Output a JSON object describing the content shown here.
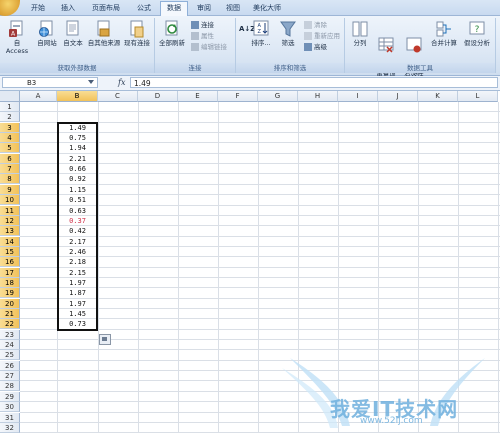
{
  "ribbon_tabs": [
    "开始",
    "插入",
    "页面布局",
    "公式",
    "数据",
    "审阅",
    "视图",
    "美化大师"
  ],
  "active_tab": "数据",
  "groups": {
    "external": {
      "label": "获取外部数据",
      "buttons": [
        "自 Access",
        "自网站",
        "自文本",
        "自其他来源",
        "现有连接"
      ]
    },
    "connections": {
      "label": "连接",
      "refresh": "全部刷新",
      "items": [
        "连接",
        "属性",
        "编辑链接"
      ]
    },
    "sort_filter": {
      "label": "排序和筛选",
      "sort_az": "A↓Z",
      "sort": "排序...",
      "filter": "筛选",
      "items": [
        "清除",
        "重新应用",
        "高级"
      ]
    },
    "data_tools": {
      "label": "数据工具",
      "buttons": [
        "分列",
        "删除\n重复项",
        "数据\n有效性",
        "合并计算",
        "假设分析"
      ]
    }
  },
  "formula_bar": {
    "name_box": "B3",
    "fx": "fx",
    "content": "1.49"
  },
  "columns": [
    "A",
    "B",
    "C",
    "D",
    "E",
    "F",
    "G",
    "H",
    "I",
    "J",
    "K",
    "L"
  ],
  "selected_column": "B",
  "rows": [
    "1",
    "2",
    "3",
    "4",
    "5",
    "6",
    "7",
    "8",
    "9",
    "10",
    "11",
    "12",
    "13",
    "14",
    "15",
    "16",
    "17",
    "18",
    "19",
    "20",
    "21",
    "22",
    "23",
    "24",
    "25",
    "26",
    "27",
    "28",
    "29",
    "30",
    "31",
    "32"
  ],
  "selected_rows": [
    "3",
    "4",
    "5",
    "6",
    "7",
    "8",
    "9",
    "10",
    "11",
    "12",
    "13",
    "14",
    "15",
    "16",
    "17",
    "18",
    "19",
    "20",
    "21",
    "22"
  ],
  "cells_b": [
    "1.49",
    "0.75",
    "1.94",
    "2.21",
    "0.66",
    "0.92",
    "1.15",
    "0.51",
    "0.63",
    "0.37",
    "0.42",
    "2.17",
    "2.46",
    "2.18",
    "2.15",
    "1.97",
    "1.87",
    "1.97",
    "1.45",
    "0.73"
  ],
  "highlight_value_index": 9,
  "colors": {
    "accent": "#d0304a",
    "selection": "#111111",
    "ribbon": "#dde8f5"
  },
  "watermark": {
    "text": "我爱IT技术网",
    "url": "www.52ij.com"
  }
}
